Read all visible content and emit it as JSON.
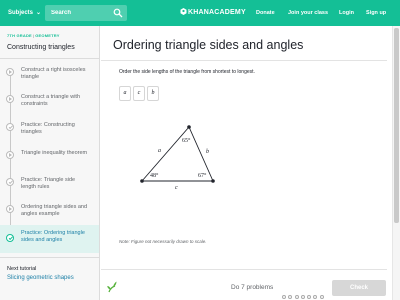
{
  "nav": {
    "subjects_label": "Subjects",
    "search_placeholder": "Search",
    "logo_text": "KHANACADEMY",
    "donate": "Donate",
    "join_class": "Join your class",
    "login": "Login",
    "signup": "Sign up",
    "bar_color": "#14bf96"
  },
  "sidebar": {
    "grade": "7TH GRADE",
    "subject": "GEOMETRY",
    "title": "Constructing triangles",
    "items": [
      {
        "label": "Construct a right isosceles triangle",
        "icon": "play-icon"
      },
      {
        "label": "Construct a triangle with constraints",
        "icon": "play-icon"
      },
      {
        "label": "Practice: Constructing triangles",
        "icon": "practice-icon"
      },
      {
        "label": "Triangle inequality theorem",
        "icon": "play-icon"
      },
      {
        "label": "Practice: Triangle side length rules",
        "icon": "practice-icon"
      },
      {
        "label": "Ordering triangle sides and angles example",
        "icon": "play-icon"
      },
      {
        "label": "Practice: Ordering triangle sides and angles",
        "icon": "practice-icon",
        "active": true
      }
    ],
    "next_tutorial_label": "Next tutorial",
    "next_tutorial_link": "Slicing geometric shapes"
  },
  "exercise": {
    "title": "Ordering triangle sides and angles",
    "prompt": "Order the side lengths of the triangle from shortest to longest.",
    "tiles": [
      "a",
      "c",
      "b"
    ],
    "figure": {
      "angles": [
        "65°",
        "48°",
        "67°"
      ],
      "sides": [
        "a",
        "b",
        "c"
      ]
    },
    "note": "Note: Figure not necessarily drawn to scale."
  },
  "footer": {
    "problems_label": "Do 7 problems",
    "progress_total": 7,
    "progress_done": 0,
    "check_label": "Check"
  }
}
